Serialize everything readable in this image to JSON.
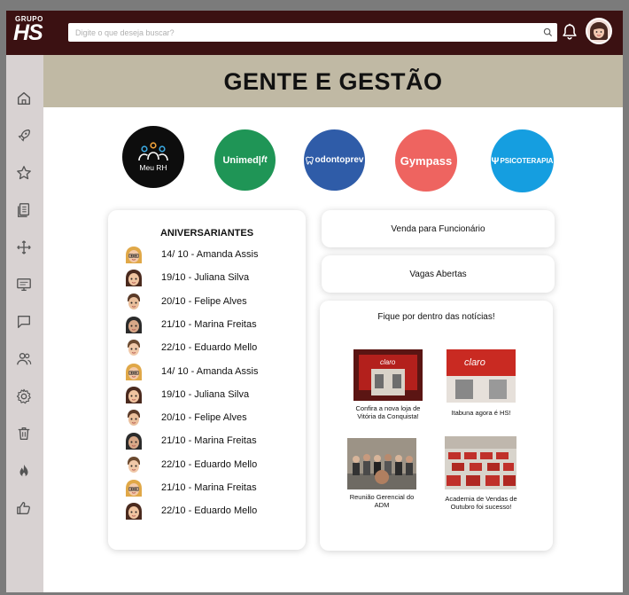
{
  "header": {
    "logo_top": "GRUPO",
    "logo_main": "HS",
    "search_placeholder": "Digite o que deseja buscar?"
  },
  "sidebar": {
    "items": [
      "home-icon",
      "rocket-icon",
      "star-icon",
      "document-icon",
      "arrows-icon",
      "monitor-icon",
      "chat-icon",
      "users-icon",
      "gear-icon",
      "trash-icon",
      "flame-icon",
      "thumbs-up-icon"
    ]
  },
  "banner": {
    "title": "GENTE E GESTÃO"
  },
  "shortcuts": {
    "meurh": "Meu RH",
    "unimed": "Unimed|",
    "odontoprev": "odontoprev",
    "gympass": "Gympass",
    "psicoterapia": "PSICOTERAPIA"
  },
  "birthdays": {
    "title": "ANIVERSARIANTES",
    "rows": [
      "14/ 10 - Amanda Assis",
      "19/10 - Juliana Silva",
      "20/10 - Felipe Alves",
      "21/10 - Marina Freitas",
      "22/10 - Eduardo Mello",
      "14/ 10 - Amanda Assis",
      "19/10 - Juliana Silva",
      "20/10 - Felipe Alves",
      "21/10 - Marina Freitas",
      "22/10 - Eduardo Mello",
      "21/10 - Marina Freitas",
      "22/10 - Eduardo Mello"
    ]
  },
  "actions": {
    "venda": "Venda para Funcionário",
    "vagas": "Vagas Abertas"
  },
  "news": {
    "title": "Fique por dentro das notícias!",
    "items": [
      {
        "caption": "Confira a nova loja de Vitória da Conquista!",
        "sign": "claro"
      },
      {
        "caption": "Itabuna agora é HS!",
        "sign": "claro"
      },
      {
        "caption": "Reunião Gerencial do ADM"
      },
      {
        "caption": "Academia de Vendas de Outubro foi sucesso!"
      }
    ]
  },
  "colors": {
    "topbar": "#3b1112",
    "sidebar": "#d8d2d2",
    "banner": "#c0b9a4",
    "unimed": "#1f9556",
    "odontoprev": "#2f5ca8",
    "gympass": "#ee6460",
    "psicoterapia": "#159ee0"
  }
}
